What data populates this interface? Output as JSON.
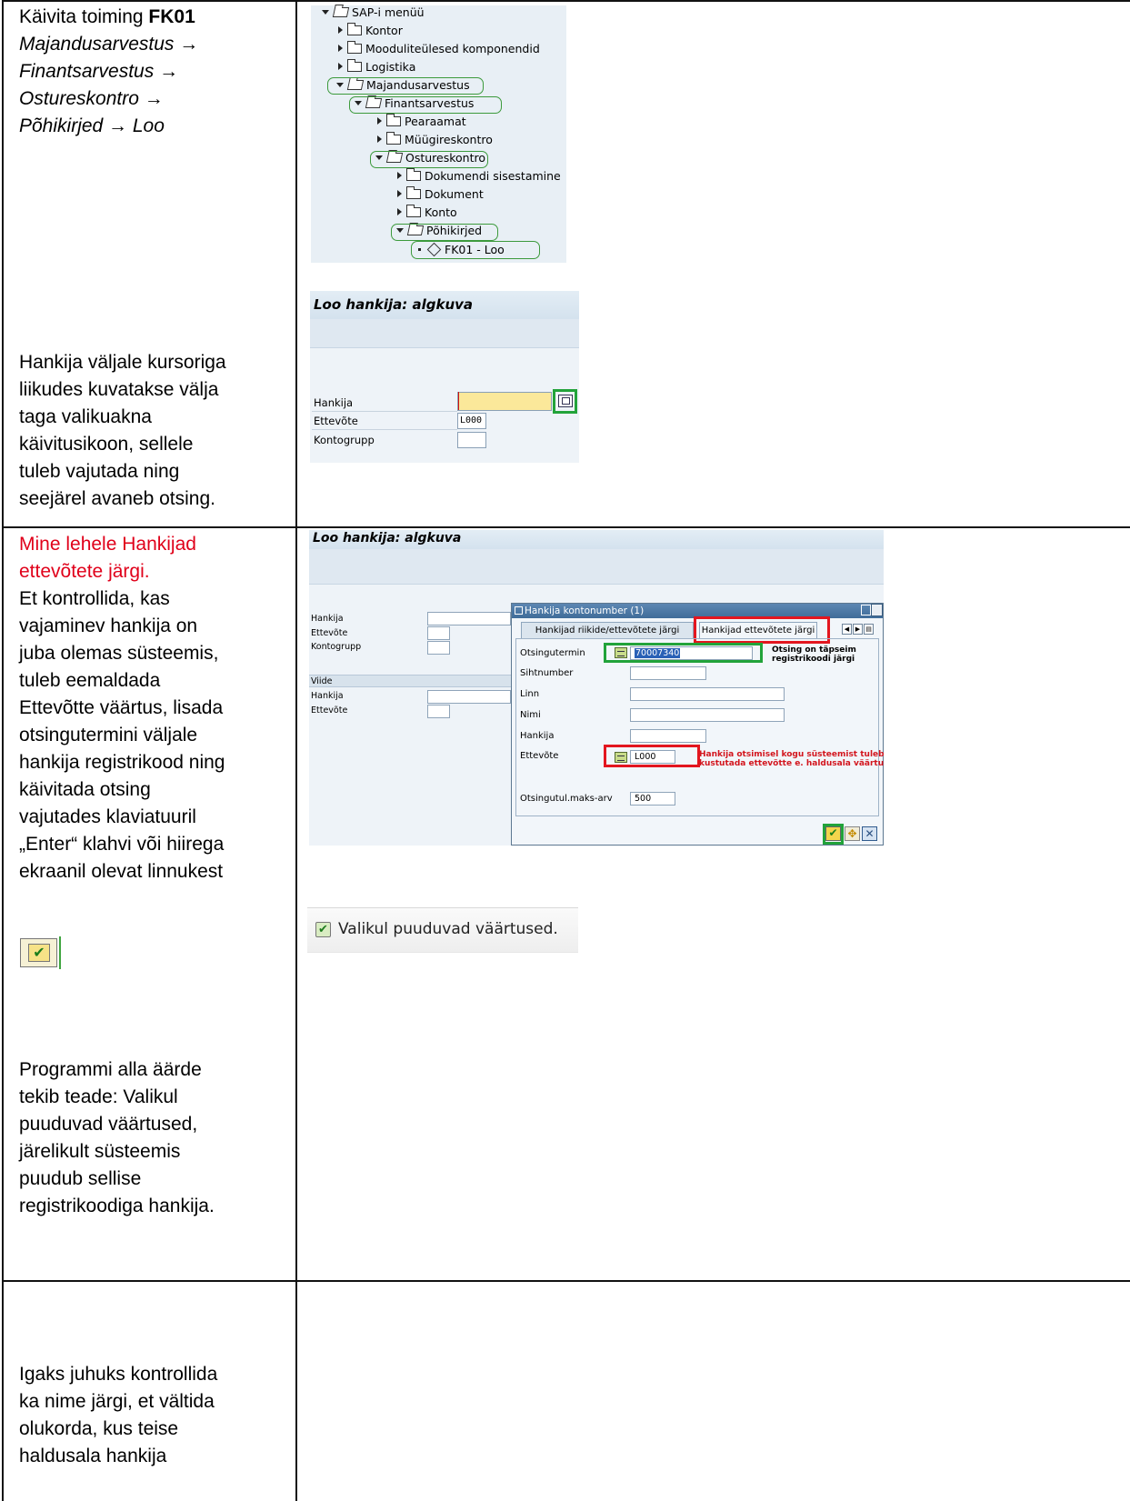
{
  "row1": {
    "instruction_prefix": "Käivita toiming ",
    "transaction_code": "FK01",
    "menu_path": [
      "Majandusarvestus →",
      "Finantsarvestus →",
      "Ostureskontro →",
      "Põhikirjed → Loo"
    ]
  },
  "tree": {
    "items": [
      {
        "label": "SAP-i menüü",
        "state": "expanded",
        "icon": "open-folder-icon"
      },
      {
        "label": "Kontor",
        "state": "collapsed",
        "icon": "folder-icon"
      },
      {
        "label": "Mooduliteülesed komponendid",
        "state": "collapsed",
        "icon": "folder-icon"
      },
      {
        "label": "Logistika",
        "state": "collapsed",
        "icon": "folder-icon"
      },
      {
        "label": "Majandusarvestus",
        "state": "expanded",
        "icon": "open-folder-icon"
      },
      {
        "label": "Finantsarvestus",
        "state": "expanded",
        "icon": "open-folder-icon"
      },
      {
        "label": "Pearaamat",
        "state": "collapsed",
        "icon": "folder-icon"
      },
      {
        "label": "Müügireskontro",
        "state": "collapsed",
        "icon": "folder-icon"
      },
      {
        "label": "Ostureskontro",
        "state": "expanded",
        "icon": "open-folder-icon"
      },
      {
        "label": "Dokumendi sisestamine",
        "state": "collapsed",
        "icon": "folder-icon"
      },
      {
        "label": "Dokument",
        "state": "collapsed",
        "icon": "folder-icon"
      },
      {
        "label": "Konto",
        "state": "collapsed",
        "icon": "folder-icon"
      },
      {
        "label": "Põhikirjed",
        "state": "expanded",
        "icon": "open-folder-icon"
      },
      {
        "label": "FK01 - Loo",
        "state": "leaf",
        "icon": "transaction-cube-icon"
      }
    ]
  },
  "hint": {
    "lines": [
      "Hankija väljale kursoriga",
      "liikudes kuvatakse välja",
      "taga valikuakna",
      "käivitusikoon, sellele",
      "tuleb vajutada ning",
      "seejärel avaneb otsing."
    ]
  },
  "screen1": {
    "title": "Loo hankija:  algkuva",
    "fields": [
      {
        "label": "Hankija",
        "value": ""
      },
      {
        "label": "Ettevõte",
        "value": "L000"
      },
      {
        "label": "Kontogrupp",
        "value": ""
      }
    ]
  },
  "row2": {
    "red_lines": [
      "Mine lehele Hankijad",
      "ettevõtete järgi."
    ],
    "lines": [
      "Et kontrollida, kas",
      "vajaminev hankija on",
      "juba olemas süsteemis,",
      "tuleb eemaldada",
      "Ettevõtte väärtus, lisada",
      "otsingutermini väljale",
      "hankija registrikood ning",
      "käivitada otsing",
      "vajutades klaviatuuril",
      "„Enter“ klahvi või hiirega",
      "ekraanil olevat linnukest"
    ],
    "result_lines": [
      "Programmi alla äärde",
      "tekib teade: Valikul",
      "puuduvad väärtused,",
      "järelikult süsteemis",
      "puudub sellise",
      "registrikoodiga hankija."
    ]
  },
  "screen2": {
    "title": "Loo hankija:  algkuva",
    "bg_fields": [
      {
        "label": "Hankija"
      },
      {
        "label": "Ettevõte"
      },
      {
        "label": "Kontogrupp"
      }
    ],
    "section_label": "Viide",
    "ref_fields": [
      {
        "label": "Hankija"
      },
      {
        "label": "Ettevõte"
      }
    ],
    "dialog": {
      "title": "Hankija kontonumber (1)",
      "tabs": [
        "Hankijad riikide/ettevõtete järgi",
        "Hankijad ettevõtete järgi"
      ],
      "fields": [
        {
          "label": "Otsingutermin",
          "value": "70007340"
        },
        {
          "label": "Sihtnumber",
          "value": ""
        },
        {
          "label": "Linn",
          "value": ""
        },
        {
          "label": "Nimi",
          "value": ""
        },
        {
          "label": "Hankija",
          "value": ""
        },
        {
          "label": "Ettevõte",
          "value": "L000"
        },
        {
          "label": "Otsingutul.maks-arv",
          "value": "500"
        }
      ],
      "note_search": "Otsing on täpseim\nregistrikoodi järgi",
      "note_company": "Hankija otsimisel kogu süsteemist tuleb\nkustutada ettevõtte e. haldusala väärtus"
    }
  },
  "message": {
    "text": "Valikul puuduvad väärtused."
  },
  "row3": {
    "lines": [
      "Igaks juhuks kontrollida",
      "ka nime järgi, et vältida",
      "olukorda, kus teise",
      "haldusala hankija"
    ]
  },
  "colors": {
    "highlight_green": "#22a33a",
    "highlight_red": "#e3161f",
    "red_text": "#e0001a",
    "sap_background": "#eef3f8"
  }
}
